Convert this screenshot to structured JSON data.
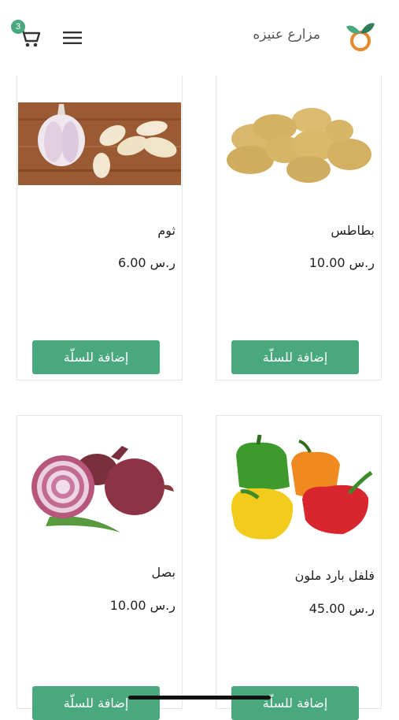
{
  "header": {
    "brand": "مزارع عنيزه",
    "cart_count": "3"
  },
  "products": [
    {
      "name": "ثوم",
      "price": "ر.س 6.00",
      "button": "إضافة للسلّة"
    },
    {
      "name": "بطاطس",
      "price": "ر.س 10.00",
      "button": "إضافة للسلّة"
    },
    {
      "name": "بصل",
      "price": "ر.س 10.00",
      "button": "إضافة للسلّة"
    },
    {
      "name": "فلفل بارد ملون",
      "price": "ر.س 45.00",
      "button": "إضافة للسلّة"
    }
  ],
  "colors": {
    "accent": "#4aa87f",
    "text": "#222222",
    "border": "#e6e6e6"
  }
}
